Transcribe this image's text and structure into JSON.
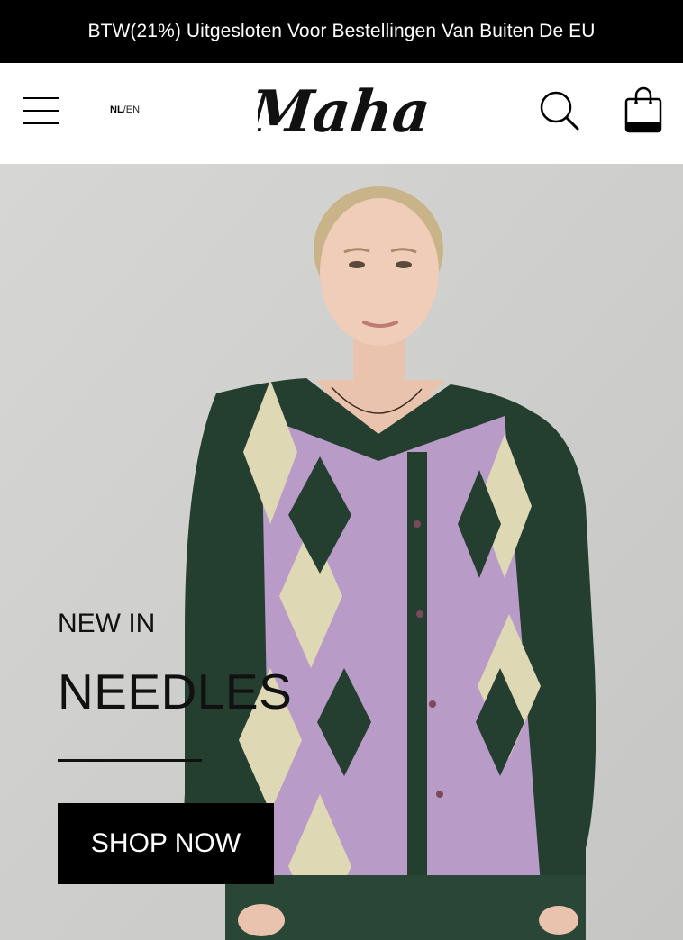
{
  "announcement": {
    "text": "BTW(21%) Uitgesloten Voor Bestellingen Van Buiten De EU"
  },
  "header": {
    "language": {
      "active": "NL",
      "separator": "/",
      "other": "EN"
    },
    "logo_text": "Maha",
    "icons": {
      "menu": "menu-icon",
      "search": "search-icon",
      "cart": "shopping-bag-icon"
    }
  },
  "hero": {
    "eyebrow": "NEW IN",
    "title": "NEEDLES",
    "cta_label": "SHOP NOW"
  },
  "colors": {
    "bar": "#000000",
    "sweater_green": "#243f30",
    "sweater_lilac": "#b99bc8",
    "sweater_cream": "#dfd8b4",
    "wall": "#cfcfcd"
  }
}
